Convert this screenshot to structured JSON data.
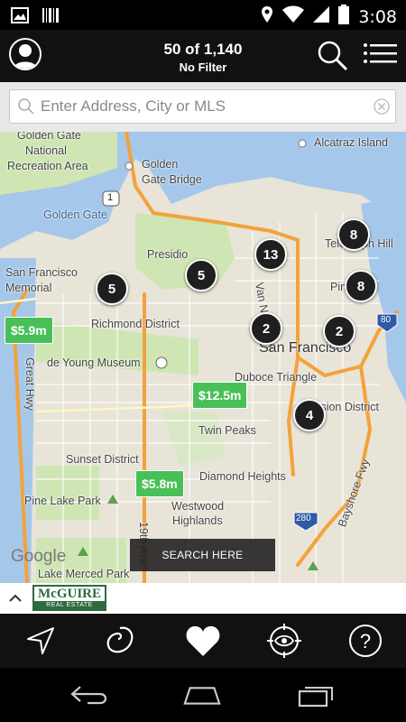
{
  "status_bar": {
    "time": "3:08"
  },
  "header": {
    "results_count": "50 of 1,140",
    "filter_label": "No Filter"
  },
  "search": {
    "placeholder": "Enter Address, City or MLS"
  },
  "map": {
    "labels": {
      "golden_gate_nra_1": "Golden Gate",
      "golden_gate_nra_2": "National",
      "golden_gate_nra_3": "Recreation Area",
      "golden_gate": "Golden Gate",
      "golden_gate_bridge_1": "Golden",
      "golden_gate_bridge_2": "Gate Bridge",
      "alcatraz": "Alcatraz Island",
      "presidio": "Presidio",
      "sf_memorial_1": "San Francisco",
      "sf_memorial_2": "Memorial",
      "telegraph_hill": "Telegraph Hill",
      "van_ness": "Van Ness Ave",
      "richmond": "Richmond District",
      "san_francisco": "San Francisco",
      "de_young": "de Young Museum",
      "duboce": "Duboce Triangle",
      "mission": "Mission District",
      "twin_peaks": "Twin Peaks",
      "sunset": "Sunset District",
      "diamond_heights": "Diamond Heights",
      "pine_lake": "Pine Lake Park",
      "westwood_1": "Westwood",
      "westwood_2": "Highlands",
      "lake_merced": "Lake Merced Park",
      "nineteenth": "19th Ave",
      "bayshore": "Bayshore Fwy",
      "great_hwy": "Great Hwy",
      "pine_label": "Pin",
      "google": "Google"
    },
    "shields": {
      "i80": "80",
      "i280": "280",
      "us101": "1"
    },
    "clusters": [
      "8",
      "13",
      "5",
      "5",
      "8",
      "2",
      "2",
      "4"
    ],
    "prices": [
      "$5.9m",
      "$12.5m",
      "$5.8m"
    ],
    "search_here_label": "SEARCH HERE"
  },
  "brand": {
    "line1": "McGUIRE",
    "line2": "REAL ESTATE"
  },
  "toolbar": {
    "help_label": "?"
  },
  "colors": {
    "price_green": "#48c057",
    "cluster_dark": "#1f1f1f",
    "highway_orange": "#f3a23a",
    "water": "#a5c7ea",
    "park": "#cfe6b4"
  }
}
